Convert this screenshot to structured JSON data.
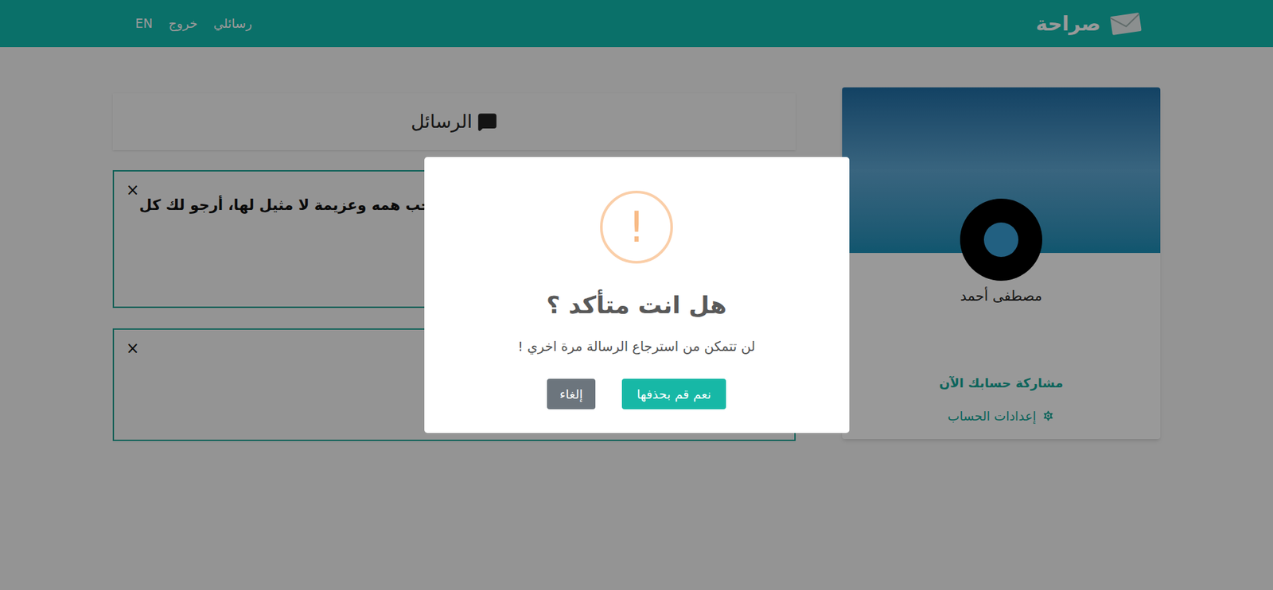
{
  "navbar": {
    "logo": "صراحة",
    "links": [
      {
        "label": "رسائلي"
      },
      {
        "label": "خروج"
      },
      {
        "label": "EN"
      }
    ]
  },
  "messages_header": {
    "title": "الرسائل"
  },
  "messages": [
    {
      "text": "صاحب همه وعزيمة لا مثيل لها، أرجو لك كل",
      "close": "×"
    },
    {
      "close": "×"
    }
  ],
  "profile": {
    "name": "مصطفى أحمد",
    "share_link": "مشاركة حسابك الآن",
    "settings_link": "إعدادات الحساب"
  },
  "dialog": {
    "icon": "!",
    "title": "هل انت متأكد ؟",
    "text": "لن تتمكن من استرجاع الرسالة مرة اخري !",
    "buttons": [
      {
        "label": "نعم قم بحذفها",
        "kind": "confirm"
      },
      {
        "label": "إلغاء",
        "kind": "cancel"
      }
    ]
  }
}
